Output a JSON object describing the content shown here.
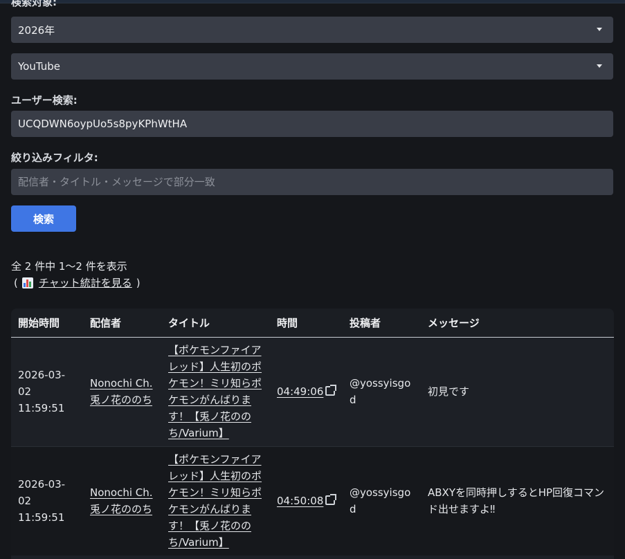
{
  "form": {
    "search_target_label": "検索対象:",
    "year_select_value": "2026年",
    "platform_select_value": "YouTube",
    "user_search_label": "ユーザー検索:",
    "user_search_value": "UCQDWN6oypUo5s8pyKPhWtHA",
    "filter_label": "絞り込みフィルタ:",
    "filter_placeholder": "配信者・タイトル・メッセージで部分一致",
    "search_button_label": "検索"
  },
  "results": {
    "summary": "全 2 件中 1〜2 件を表示",
    "stats_open_paren": "(",
    "stats_icon": "bar-chart-icon",
    "stats_link": "チャット統計を見る",
    "stats_close_paren": ")"
  },
  "table": {
    "headers": [
      "開始時間",
      "配信者",
      "タイトル",
      "時間",
      "投稿者",
      "メッセージ"
    ],
    "rows": [
      {
        "start_time": "2026-03-02 11:59:51",
        "streamer": "Nonochi Ch. 兎ノ花ののち",
        "title": "【ポケモンファイアレッド】人生初のポケモン！ミリ知らポケモンがんばります！【兎ノ花ののち/Varium】",
        "time": "04:49:06",
        "poster": "@yossyisgod",
        "message": "初見です"
      },
      {
        "start_time": "2026-03-02 11:59:51",
        "streamer": "Nonochi Ch. 兎ノ花ののち",
        "title": "【ポケモンファイアレッド】人生初のポケモン！ミリ知らポケモンがんばります！【兎ノ花ののち/Varium】",
        "time": "04:50:08",
        "poster": "@yossyisgod",
        "message": "ABXYを同時押しするとHP回復コマンド出せますよ‼"
      }
    ]
  }
}
